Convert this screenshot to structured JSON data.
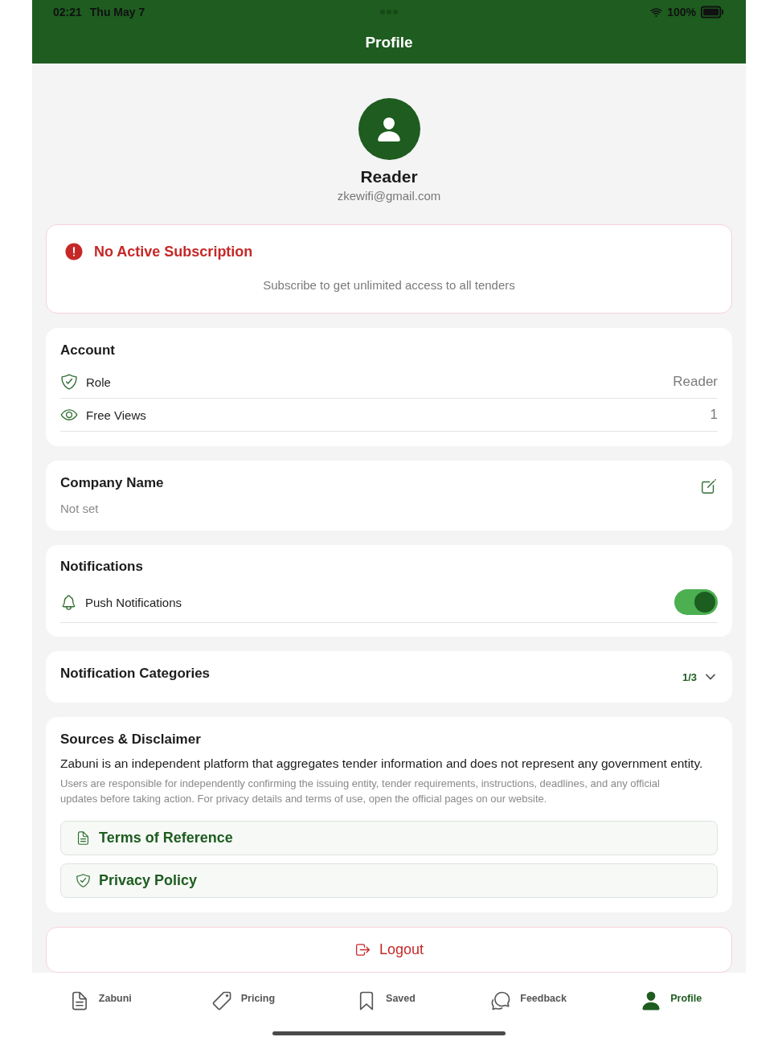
{
  "status_bar": {
    "time": "02:21",
    "date": "Thu May 7",
    "battery": "100%"
  },
  "header": {
    "title": "Profile"
  },
  "profile": {
    "name": "Reader",
    "email": "zkewifi@gmail.com"
  },
  "subscription_alert": {
    "title": "No Active Subscription",
    "message": "Subscribe to get unlimited access to all tenders"
  },
  "account": {
    "title": "Account",
    "rows": [
      {
        "kind": "shield",
        "label": "Role",
        "value": "Reader"
      },
      {
        "kind": "eye",
        "label": "Free Views",
        "value": "1"
      }
    ]
  },
  "company": {
    "title": "Company Name",
    "value": "Not set"
  },
  "notifications": {
    "title": "Notifications",
    "rows": [
      {
        "kind": "bell",
        "label": "Push Notifications",
        "on": true
      }
    ]
  },
  "notification_categories": {
    "title": "Notification Categories",
    "count": "1/3",
    "expanded": false
  },
  "disclaimer": {
    "title": "Sources & Disclaimer",
    "statement": "Zabuni is an independent platform that aggregates tender information and does not represent any government entity.",
    "note": "Users are responsible for independently confirming the issuing entity, tender requirements, instructions, deadlines, and any official updates before taking action. For privacy details and terms of use, open the official pages on our website.",
    "links": [
      {
        "kind": "document",
        "label": "Terms of Reference"
      },
      {
        "kind": "shield",
        "label": "Privacy Policy"
      }
    ]
  },
  "logout": {
    "label": "Logout"
  },
  "tab_bar": [
    {
      "kind": "document",
      "label": "Zabuni",
      "selected": false
    },
    {
      "kind": "tag",
      "label": "Pricing",
      "selected": false
    },
    {
      "kind": "bookmark",
      "label": "Saved",
      "selected": false
    },
    {
      "kind": "chat",
      "label": "Feedback",
      "selected": false
    },
    {
      "kind": "person",
      "label": "Profile",
      "selected": true
    }
  ]
}
